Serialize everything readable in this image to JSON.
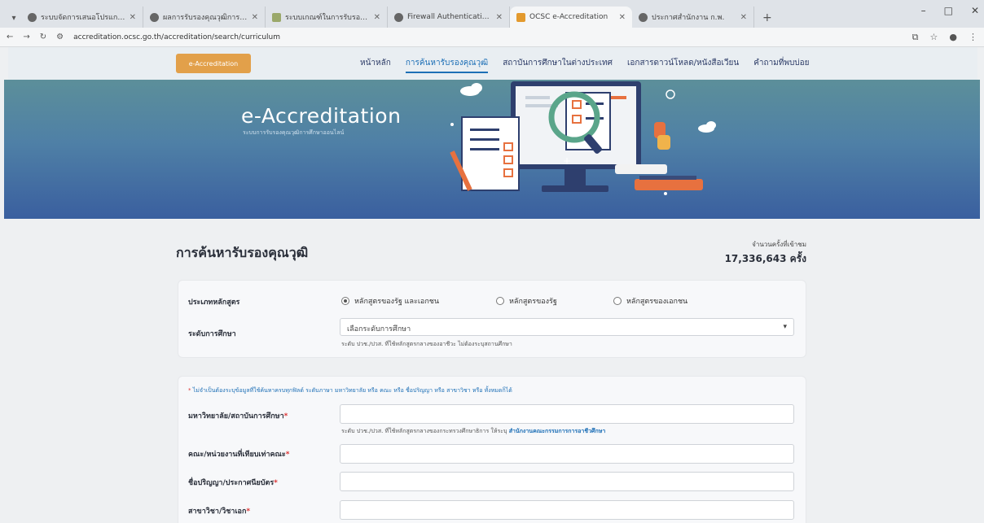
{
  "browser": {
    "tabs": [
      {
        "title": "ระบบจัดการเสนอโปรแกรมประสานระบบ",
        "active": false,
        "icon": "globe-icon"
      },
      {
        "title": "ผลการรับรองคุณวุฒิการศึกษา",
        "active": false,
        "icon": "globe-icon"
      },
      {
        "title": "ระบบเกณฑ์ในการรับรองคุณวุฒิ",
        "active": false,
        "icon": "doc-icon"
      },
      {
        "title": "Firewall Authentication Keepali",
        "active": false,
        "icon": "globe-icon"
      },
      {
        "title": "OCSC e-Accreditation",
        "active": true,
        "icon": "ocsc-icon"
      },
      {
        "title": "ประกาศสำนักงาน ก.พ.",
        "active": false,
        "icon": "globe-icon"
      }
    ],
    "url": "accreditation.ocsc.go.th/accreditation/search/curriculum"
  },
  "nav": {
    "logo": "e-Accreditation",
    "links": [
      "หน้าหลัก",
      "การค้นหารับรองคุณวุฒิ",
      "สถาบันการศึกษาในต่างประเทศ",
      "เอกสารดาวน์โหลด/หนังสือเวียน",
      "คำถามที่พบบ่อย"
    ],
    "active_index": 1
  },
  "hero": {
    "title": "e-Accreditation",
    "subtitle": "ระบบการรับรองคุณวุฒิการศึกษาออนไลน์"
  },
  "page": {
    "title": "การค้นหารับรองคุณวุฒิ",
    "count_label": "จำนวนครั้งที่เข้าชม",
    "count_value": "17,336,643 ครั้ง"
  },
  "form1": {
    "type_label": "ประเภทหลักสูตร",
    "type_options": [
      "หลักสูตรของรัฐ และเอกชน",
      "หลักสูตรของรัฐ",
      "หลักสูตรของเอกชน"
    ],
    "type_selected": 0,
    "level_label": "ระดับการศึกษา",
    "level_placeholder": "เลือกระดับการศึกษา",
    "level_hint": "ระดับ ปวช./ปวส. ที่ใช้หลักสูตรกลางของอาชีวะ ไม่ต้องระบุสถานศึกษา"
  },
  "form2": {
    "note": "ไม่จำเป็นต้องระบุข้อมูลที่ใช้ค้นหาครบทุกฟิลด์ ระดับภาษา มหาวิทยาลัย หรือ คณะ หรือ ชื่อปริญญา หรือ สาขาวิชา หรือ ทั้งหมดก็ได้",
    "university_label": "มหาวิทยาลัย/สถาบันการศึกษา",
    "university_hint": "ระดับ ปวช./ปวส. ที่ใช้หลักสูตรกลางของกระทรวงศึกษาธิการ ให้ระบุ",
    "university_hint_link": "สำนักงานคณะกรรมการการอาชีวศึกษา",
    "faculty_label": "คณะ/หน่วยงานที่เทียบเท่าคณะ",
    "degree_label": "ชื่อปริญญา/ประกาศนียบัตร",
    "major_label": "สาขาวิชา/วิชาเอก"
  }
}
